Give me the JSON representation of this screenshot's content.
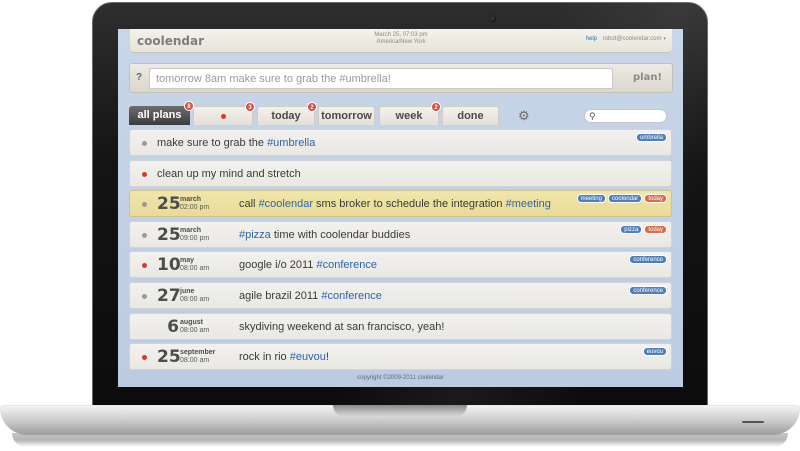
{
  "app": {
    "logo": "coolendar",
    "date": "March 25, 07:03 pm",
    "timezone": "America/New York",
    "help": "help",
    "account": "robot@coolendar.com",
    "account_caret": "▾"
  },
  "quickadd": {
    "prompt": "?",
    "placeholder": "tomorrow 8am make sure to grab the #umbrella!",
    "button": "plan!"
  },
  "tabs": [
    {
      "label": "all plans",
      "badge": "8"
    },
    {
      "label": "",
      "badge": "3",
      "icon": "red-dot"
    },
    {
      "label": "today",
      "badge": "2"
    },
    {
      "label": "tomorrow",
      "badge": ""
    },
    {
      "label": "week",
      "badge": "2"
    },
    {
      "label": "done",
      "badge": ""
    }
  ],
  "icons": {
    "gear": "gear-icon",
    "search": "search-icon"
  },
  "items": [
    {
      "text": "make sure to grab the ",
      "tag": "#umbrella",
      "after": "",
      "labels": [
        "umbrella"
      ]
    },
    {
      "text": "clean up my mind and stretch",
      "tag": "",
      "after": "",
      "labels": []
    },
    {
      "day": "25",
      "month": "march",
      "time": "02:00 pm",
      "text": "call ",
      "tag": "#coolendar",
      "after": " sms broker to schedule the integration ",
      "tag2": "#meeting",
      "labels": [
        "meeting",
        "coolendar",
        "today"
      ]
    },
    {
      "day": "25",
      "month": "march",
      "time": "09:00 pm",
      "text": "",
      "tag": "#pizza",
      "after": " time with coolendar buddies",
      "labels": [
        "pizza",
        "today"
      ]
    },
    {
      "day": "10",
      "month": "may",
      "time": "08:00 am",
      "text": "google i/o 2011 ",
      "tag": "#conference",
      "after": "",
      "labels": [
        "conference"
      ]
    },
    {
      "day": "27",
      "month": "june",
      "time": "08:00 am",
      "text": "agile brazil 2011 ",
      "tag": "#conference",
      "after": "",
      "labels": [
        "conference"
      ]
    },
    {
      "day": "6",
      "month": "august",
      "time": "08:00 am",
      "text": "skydiving weekend at san francisco, yeah!",
      "tag": "",
      "after": "",
      "labels": []
    },
    {
      "day": "25",
      "month": "september",
      "time": "08:00 am",
      "text": "rock in rio ",
      "tag": "#euvou",
      "after": "!",
      "labels": [
        "euvou"
      ]
    }
  ],
  "footer": "copyright ©2009-2011 coolendar",
  "colors": {
    "accent": "#2f63a9",
    "highlight": "#f1e6ab",
    "danger": "#d8382a",
    "label": "#4e7fb8"
  }
}
